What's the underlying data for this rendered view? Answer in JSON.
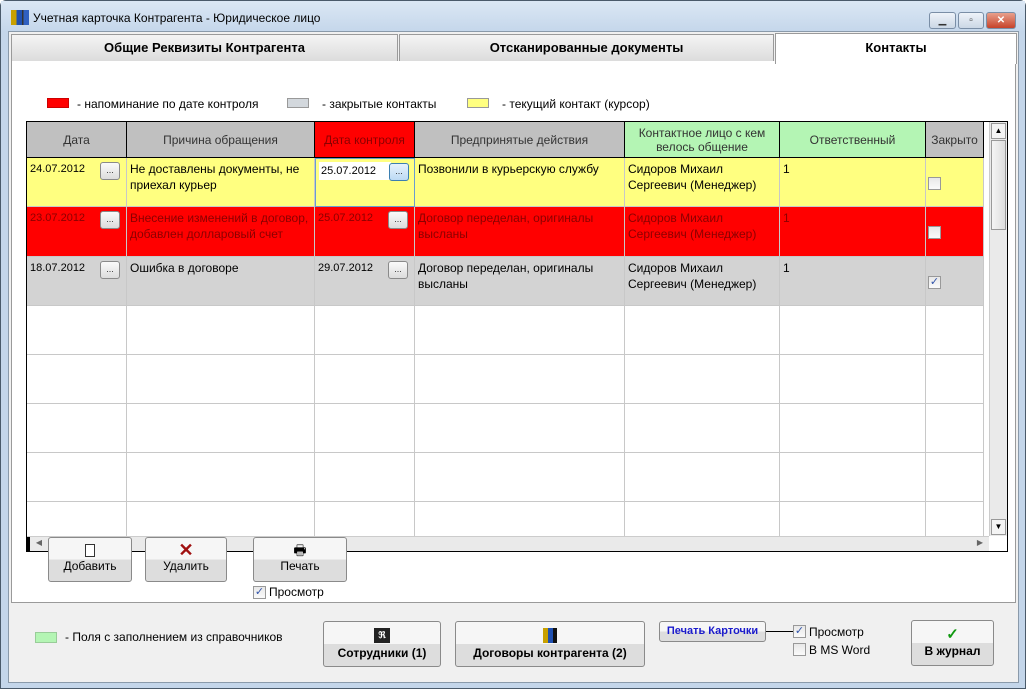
{
  "window": {
    "title": "Учетная карточка Контрагента - Юридическое лицо",
    "minimize": "▁",
    "maximize": "▫",
    "close": "✕"
  },
  "tabs": [
    {
      "label": "Общие Реквизиты Контрагента"
    },
    {
      "label": "Отсканированные документы"
    },
    {
      "label": "Контакты",
      "active": true
    }
  ],
  "legend": {
    "red": "- напоминание по дате контроля",
    "gray": "- закрытые контакты",
    "yellow": "- текущий контакт (курсор)",
    "green": "-  Поля с заполнением из справочников"
  },
  "colors": {
    "red": "#ff0000",
    "gray": "#d3d3d3",
    "yellow": "#ffff80",
    "green": "#b4f5b4",
    "red_text": "#8b0000"
  },
  "grid": {
    "columns": [
      "Дата",
      "Причина обращения",
      "Дата контроля",
      "Предпринятые действия",
      "Контактное лицо с кем велось общение",
      "Ответственный",
      "Закрыто"
    ],
    "rows": [
      {
        "date": "24.07.2012",
        "reason": "Не доставлены документы, не приехал курьер",
        "control_date": "25.07.2012",
        "actions": "Позвонили в курьерскую службу",
        "contact": "Сидоров Михаил Сергеевич (Менеджер)",
        "responsible": "1",
        "closed": false,
        "state": "current"
      },
      {
        "date": "23.07.2012",
        "reason": "Внесение изменений в договор, добавлен долларовый счет",
        "control_date": "25.07.2012",
        "actions": "Договор переделан, оригиналы высланы",
        "contact": "Сидоров Михаил Сергеевич (Менеджер)",
        "responsible": "1",
        "closed": false,
        "state": "reminder"
      },
      {
        "date": "18.07.2012",
        "reason": "Ошибка в договоре",
        "control_date": "29.07.2012",
        "actions": "Договор переделан, оригиналы высланы",
        "contact": "Сидоров Михаил Сергеевич (Менеджер)",
        "responsible": "1",
        "closed": true,
        "state": "closed"
      }
    ],
    "ellipsis": "..."
  },
  "buttons": {
    "add": "Добавить",
    "delete": "Удалить",
    "print": "Печать",
    "preview": "Просмотр",
    "employees": "Сотрудники (1)",
    "contracts": "Договоры контрагента (2)",
    "print_card": "Печать Карточки",
    "card_preview": "Просмотр",
    "ms_word": "В MS Word",
    "journal": "В журнал"
  }
}
